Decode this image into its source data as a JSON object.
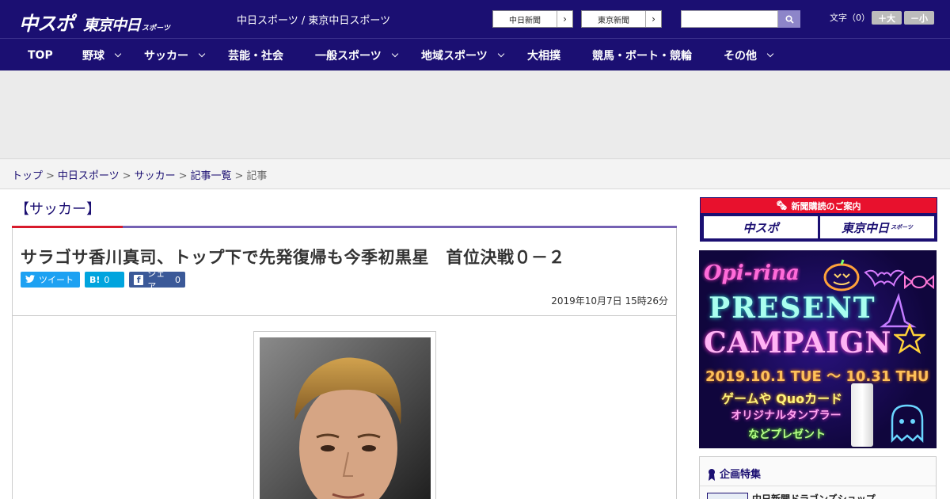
{
  "header": {
    "logo_main": "中スポ",
    "logo_sub": "東京中日",
    "logo_suffix": "スポーツ",
    "site_names": "中日スポーツ / 東京中日スポーツ",
    "newspaper_buttons": [
      "中日新聞",
      "東京新聞"
    ],
    "search_placeholder": "",
    "font_size_label": "文字（0）",
    "font_bigger": "＋大",
    "font_smaller": "－小"
  },
  "nav": {
    "items": [
      {
        "label": "TOP",
        "dropdown": false
      },
      {
        "label": "野球",
        "dropdown": true
      },
      {
        "label": "サッカー",
        "dropdown": true
      },
      {
        "label": "芸能・社会",
        "dropdown": false
      },
      {
        "label": "一般スポーツ",
        "dropdown": true
      },
      {
        "label": "地域スポーツ",
        "dropdown": true
      },
      {
        "label": "大相撲",
        "dropdown": false
      },
      {
        "label": "競馬・ボート・競輪",
        "dropdown": false
      },
      {
        "label": "その他",
        "dropdown": true
      }
    ]
  },
  "breadcrumb": {
    "items": [
      "トップ",
      "中日スポーツ",
      "サッカー",
      "記事一覧"
    ],
    "current": "記事",
    "separator": ">"
  },
  "article": {
    "category": "【サッカー】",
    "headline": "サラゴサ香川真司、トップ下で先発復帰も今季初黒星　首位決戦０－２",
    "date": "2019年10月7日 15時26分",
    "share": {
      "tweet_label": "ツイート",
      "hatena_count": "0",
      "facebook_label": "シェア",
      "facebook_count": "0"
    }
  },
  "sidebar": {
    "subscription_title": "新聞購読のご案内",
    "subscription_buttons": [
      "中スポ",
      "東京中日"
    ],
    "subscription_suffix": "スポーツ",
    "campaign": {
      "brand": "Opi-rina",
      "line1": "PRESENT",
      "line2": "CAMPAIGN",
      "dates": "2019.10.1 TUE 〜 10.31 THU",
      "text1": "ゲームや Quoカード",
      "text2": "オリジナルタンブラー",
      "text3": "などプレゼント"
    },
    "feature_title": "企画特集",
    "feature_item": "中日新聞ドラゴンズショップ"
  },
  "colors": {
    "brand_navy": "#1b0f72",
    "accent_red": "#e8112d",
    "section_purple": "#7561b3",
    "twitter_blue": "#1da1f2",
    "hatena_blue": "#00a4de",
    "facebook_blue": "#3b5998"
  }
}
